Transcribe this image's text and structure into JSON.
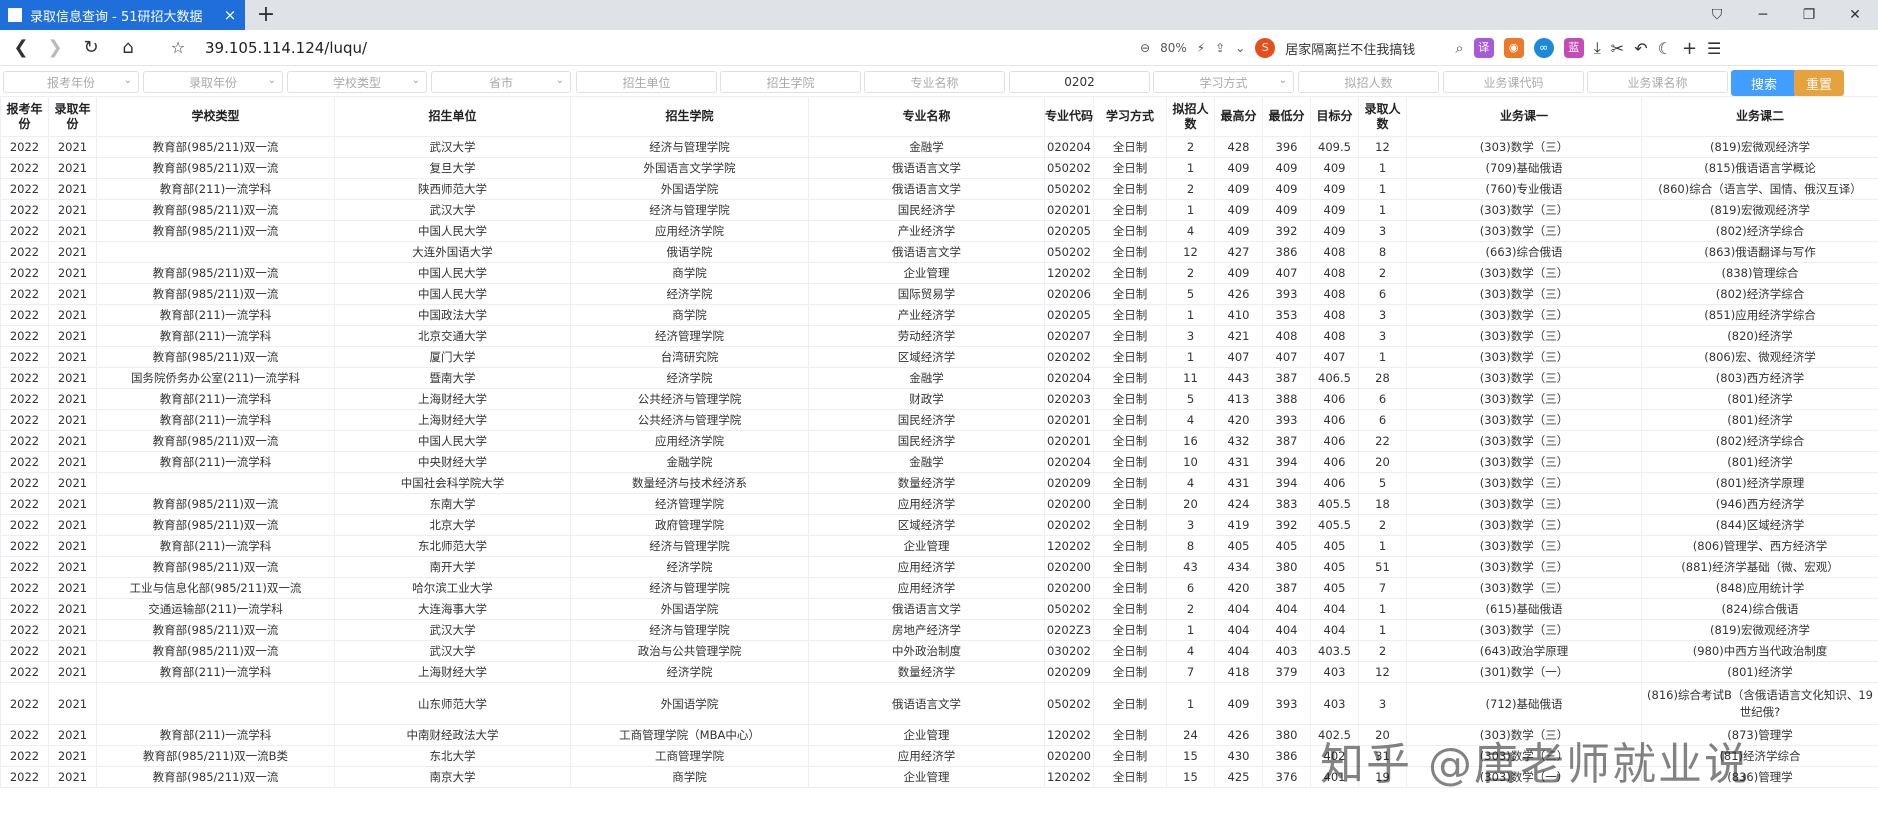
{
  "browser": {
    "tab_title": "录取信息查询 - 51研招大数据",
    "url": "39.105.114.124/luqu/",
    "zoom": "80%",
    "search_hint": "居家隔离拦不住我搞钱",
    "ext_labels": [
      "译",
      "",
      "",
      "蓝"
    ]
  },
  "filters": {
    "placeholders": [
      "报考年份",
      "录取年份",
      "学校类型",
      "省市",
      "招生单位",
      "招生学院",
      "专业名称",
      "0202",
      "学习方式",
      "拟招人数",
      "业务课代码",
      "业务课名称"
    ],
    "search_label": "搜索",
    "reset_label": "重置"
  },
  "columns": [
    "报考年份",
    "录取年份",
    "学校类型",
    "招生单位",
    "招生学院",
    "专业名称",
    "专业代码",
    "学习方式",
    "拟招人数",
    "最高分",
    "最低分",
    "目标分",
    "录取人数",
    "业务课一",
    "业务课二"
  ],
  "rows": [
    [
      "2022",
      "2021",
      "教育部(985/211)双一流",
      "武汉大学",
      "经济与管理学院",
      "金融学",
      "020204",
      "全日制",
      "2",
      "428",
      "396",
      "409.5",
      "12",
      "(303)数学（三）",
      "(819)宏微观经济学"
    ],
    [
      "2022",
      "2021",
      "教育部(985/211)双一流",
      "复旦大学",
      "外国语言文学学院",
      "俄语语言文学",
      "050202",
      "全日制",
      "1",
      "409",
      "409",
      "409",
      "1",
      "(709)基础俄语",
      "(815)俄语语言学概论"
    ],
    [
      "2022",
      "2021",
      "教育部(211)一流学科",
      "陕西师范大学",
      "外国语学院",
      "俄语语言文学",
      "050202",
      "全日制",
      "2",
      "409",
      "409",
      "409",
      "1",
      "(760)专业俄语",
      "(860)综合（语言学、国情、俄汉互译）"
    ],
    [
      "2022",
      "2021",
      "教育部(985/211)双一流",
      "武汉大学",
      "经济与管理学院",
      "国民经济学",
      "020201",
      "全日制",
      "1",
      "409",
      "409",
      "409",
      "1",
      "(303)数学（三）",
      "(819)宏微观经济学"
    ],
    [
      "2022",
      "2021",
      "教育部(985/211)双一流",
      "中国人民大学",
      "应用经济学院",
      "产业经济学",
      "020205",
      "全日制",
      "4",
      "409",
      "392",
      "409",
      "3",
      "(303)数学（三）",
      "(802)经济学综合"
    ],
    [
      "2022",
      "2021",
      "",
      "大连外国语大学",
      "俄语学院",
      "俄语语言文学",
      "050202",
      "全日制",
      "12",
      "427",
      "386",
      "408",
      "8",
      "(663)综合俄语",
      "(863)俄语翻译与写作"
    ],
    [
      "2022",
      "2021",
      "教育部(985/211)双一流",
      "中国人民大学",
      "商学院",
      "企业管理",
      "120202",
      "全日制",
      "2",
      "409",
      "407",
      "408",
      "2",
      "(303)数学（三）",
      "(838)管理综合"
    ],
    [
      "2022",
      "2021",
      "教育部(985/211)双一流",
      "中国人民大学",
      "经济学院",
      "国际贸易学",
      "020206",
      "全日制",
      "5",
      "426",
      "393",
      "408",
      "6",
      "(303)数学（三）",
      "(802)经济学综合"
    ],
    [
      "2022",
      "2021",
      "教育部(211)一流学科",
      "中国政法大学",
      "商学院",
      "产业经济学",
      "020205",
      "全日制",
      "1",
      "410",
      "353",
      "408",
      "3",
      "(303)数学（三）",
      "(851)应用经济学综合"
    ],
    [
      "2022",
      "2021",
      "教育部(211)一流学科",
      "北京交通大学",
      "经济管理学院",
      "劳动经济学",
      "020207",
      "全日制",
      "3",
      "421",
      "408",
      "408",
      "3",
      "(303)数学（三）",
      "(820)经济学"
    ],
    [
      "2022",
      "2021",
      "教育部(985/211)双一流",
      "厦门大学",
      "台湾研究院",
      "区域经济学",
      "020202",
      "全日制",
      "1",
      "407",
      "407",
      "407",
      "1",
      "(303)数学（三）",
      "(806)宏、微观经济学"
    ],
    [
      "2022",
      "2021",
      "国务院侨务办公室(211)一流学科",
      "暨南大学",
      "经济学院",
      "金融学",
      "020204",
      "全日制",
      "11",
      "443",
      "387",
      "406.5",
      "28",
      "(303)数学（三）",
      "(803)西方经济学"
    ],
    [
      "2022",
      "2021",
      "教育部(211)一流学科",
      "上海财经大学",
      "公共经济与管理学院",
      "财政学",
      "020203",
      "全日制",
      "5",
      "413",
      "388",
      "406",
      "6",
      "(303)数学（三）",
      "(801)经济学"
    ],
    [
      "2022",
      "2021",
      "教育部(211)一流学科",
      "上海财经大学",
      "公共经济与管理学院",
      "国民经济学",
      "020201",
      "全日制",
      "4",
      "420",
      "393",
      "406",
      "6",
      "(303)数学（三）",
      "(801)经济学"
    ],
    [
      "2022",
      "2021",
      "教育部(985/211)双一流",
      "中国人民大学",
      "应用经济学院",
      "国民经济学",
      "020201",
      "全日制",
      "16",
      "432",
      "387",
      "406",
      "22",
      "(303)数学（三）",
      "(802)经济学综合"
    ],
    [
      "2022",
      "2021",
      "教育部(211)一流学科",
      "中央财经大学",
      "金融学院",
      "金融学",
      "020204",
      "全日制",
      "10",
      "431",
      "394",
      "406",
      "20",
      "(303)数学（三）",
      "(801)经济学"
    ],
    [
      "2022",
      "2021",
      "",
      "中国社会科学院大学",
      "数量经济与技术经济系",
      "数量经济学",
      "020209",
      "全日制",
      "4",
      "431",
      "394",
      "406",
      "5",
      "(303)数学（三）",
      "(801)经济学原理"
    ],
    [
      "2022",
      "2021",
      "教育部(985/211)双一流",
      "东南大学",
      "经济管理学院",
      "应用经济学",
      "020200",
      "全日制",
      "20",
      "424",
      "383",
      "405.5",
      "18",
      "(303)数学（三）",
      "(946)西方经济学"
    ],
    [
      "2022",
      "2021",
      "教育部(985/211)双一流",
      "北京大学",
      "政府管理学院",
      "区域经济学",
      "020202",
      "全日制",
      "3",
      "419",
      "392",
      "405.5",
      "2",
      "(303)数学（三）",
      "(844)区域经济学"
    ],
    [
      "2022",
      "2021",
      "教育部(211)一流学科",
      "东北师范大学",
      "经济与管理学院",
      "企业管理",
      "120202",
      "全日制",
      "8",
      "405",
      "405",
      "405",
      "1",
      "(303)数学（三）",
      "(806)管理学、西方经济学"
    ],
    [
      "2022",
      "2021",
      "教育部(985/211)双一流",
      "南开大学",
      "经济学院",
      "应用经济学",
      "020200",
      "全日制",
      "43",
      "434",
      "380",
      "405",
      "51",
      "(303)数学（三）",
      "(881)经济学基础（微、宏观）"
    ],
    [
      "2022",
      "2021",
      "工业与信息化部(985/211)双一流",
      "哈尔滨工业大学",
      "经济与管理学院",
      "应用经济学",
      "020200",
      "全日制",
      "6",
      "420",
      "387",
      "405",
      "7",
      "(303)数学（三）",
      "(848)应用统计学"
    ],
    [
      "2022",
      "2021",
      "交通运输部(211)一流学科",
      "大连海事大学",
      "外国语学院",
      "俄语语言文学",
      "050202",
      "全日制",
      "2",
      "404",
      "404",
      "404",
      "1",
      "(615)基础俄语",
      "(824)综合俄语"
    ],
    [
      "2022",
      "2021",
      "教育部(985/211)双一流",
      "武汉大学",
      "经济与管理学院",
      "房地产经济学",
      "0202Z3",
      "全日制",
      "1",
      "404",
      "404",
      "404",
      "1",
      "(303)数学（三）",
      "(819)宏微观经济学"
    ],
    [
      "2022",
      "2021",
      "教育部(985/211)双一流",
      "武汉大学",
      "政治与公共管理学院",
      "中外政治制度",
      "030202",
      "全日制",
      "4",
      "404",
      "403",
      "403.5",
      "2",
      "(643)政治学原理",
      "(980)中西方当代政治制度"
    ],
    [
      "2022",
      "2021",
      "教育部(211)一流学科",
      "上海财经大学",
      "经济学院",
      "数量经济学",
      "020209",
      "全日制",
      "7",
      "418",
      "379",
      "403",
      "12",
      "(301)数学（一）",
      "(801)经济学"
    ],
    [
      "2022",
      "2021",
      "",
      "山东师范大学",
      "外国语学院",
      "俄语语言文学",
      "050202",
      "全日制",
      "1",
      "409",
      "393",
      "403",
      "3",
      "(712)基础俄语",
      "(816)综合考试B（含俄语语言文化知识、19世纪俄?"
    ],
    [
      "2022",
      "2021",
      "教育部(211)一流学科",
      "中南财经政法大学",
      "工商管理学院（MBA中心）",
      "企业管理",
      "120202",
      "全日制",
      "24",
      "426",
      "380",
      "402.5",
      "20",
      "(303)数学（三）",
      "(873)管理学"
    ],
    [
      "2022",
      "2021",
      "教育部(985/211)双一流B类",
      "东北大学",
      "工商管理学院",
      "应用经济学",
      "020200",
      "全日制",
      "15",
      "430",
      "386",
      "402",
      "31",
      "(303)数学（三）",
      "(81)经济学综合"
    ],
    [
      "2022",
      "2021",
      "教育部(985/211)双一流",
      "南京大学",
      "商学院",
      "企业管理",
      "120202",
      "全日制",
      "15",
      "425",
      "376",
      "401",
      "19",
      "(303)数学（一）",
      "(836)管理学"
    ]
  ],
  "watermark": "知乎 @唐老师就业说"
}
